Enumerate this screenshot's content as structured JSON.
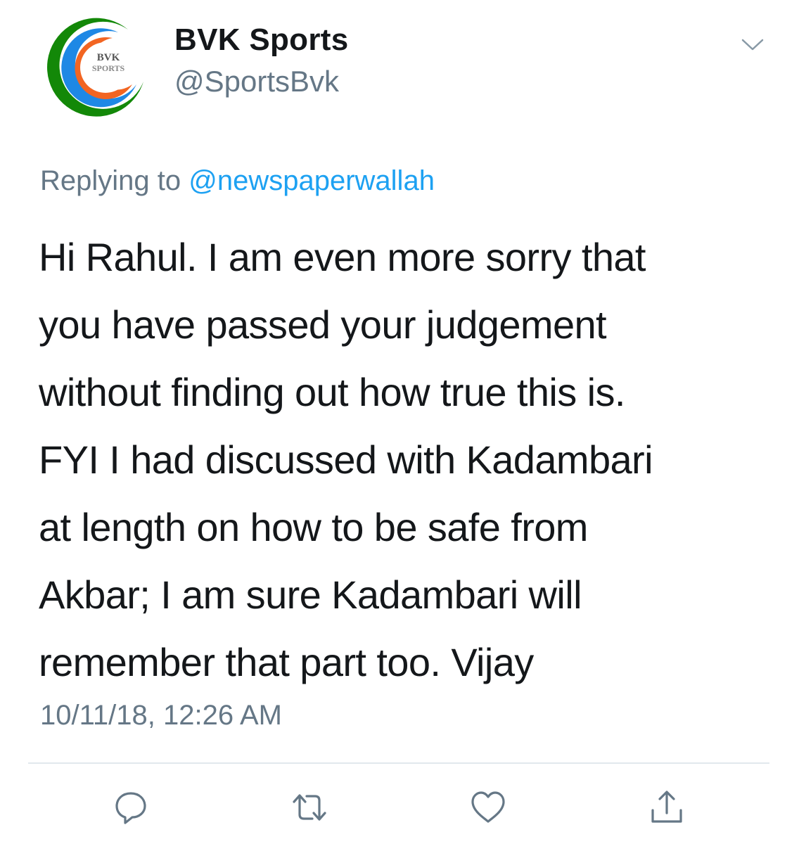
{
  "account": {
    "display_name": "BVK Sports",
    "handle": "@SportsBvk",
    "avatar_icon": "bvk-sports-logo-icon",
    "avatar_logo_line1": "BVK",
    "avatar_logo_line2": "SPORTS"
  },
  "header": {
    "caret_icon": "chevron-down-icon"
  },
  "reply": {
    "prefix": "Replying to",
    "mention": "@newspaperwallah"
  },
  "tweet": {
    "lines": [
      "Hi Rahul. I am even more sorry that",
      "you have passed your judgement",
      "without finding out how true this is.",
      "FYI I had discussed with Kadambari",
      "at length on how to be safe from",
      "Akbar; I am sure Kadambari will",
      "remember that part too. Vijay"
    ],
    "timestamp": "10/11/18, 12:26 AM"
  },
  "actions": {
    "reply_icon": "reply-icon",
    "retweet_icon": "retweet-icon",
    "like_icon": "heart-icon",
    "share_icon": "share-icon"
  },
  "colors": {
    "text": "#14171a",
    "secondary": "#657786",
    "link": "#1da1f2",
    "divider": "#e1e8ed",
    "logo_green": "#138808",
    "logo_orange": "#f26522",
    "logo_blue": "#1e88e5"
  }
}
